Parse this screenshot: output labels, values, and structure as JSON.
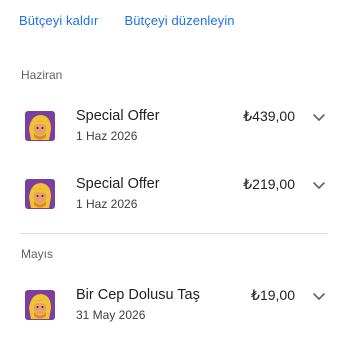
{
  "actions": {
    "remove_budget": "Bütçeyi kaldır",
    "edit_budget": "Bütçeyi düzenleyin"
  },
  "sections": [
    {
      "title": "Haziran",
      "items": [
        {
          "title": "Special Offer",
          "date": "1 Haz 2026",
          "price": "₺439,00",
          "icon": "clash-barbarian-app-icon"
        },
        {
          "title": "Special Offer",
          "date": "1 Haz 2026",
          "price": "₺219,00",
          "icon": "clash-barbarian-app-icon"
        }
      ]
    },
    {
      "title": "Mayıs",
      "items": [
        {
          "title": "Bir Cep Dolusu Taş",
          "date": "31 May 2026",
          "price": "₺19,00",
          "icon": "clash-barbarian-app-icon"
        }
      ]
    }
  ],
  "colors": {
    "link": "#1a73e8",
    "section_title": "#5f6368",
    "divider": "#dadce0",
    "icon_background": "#7b3fa0",
    "icon_hair": "#f2c230"
  }
}
